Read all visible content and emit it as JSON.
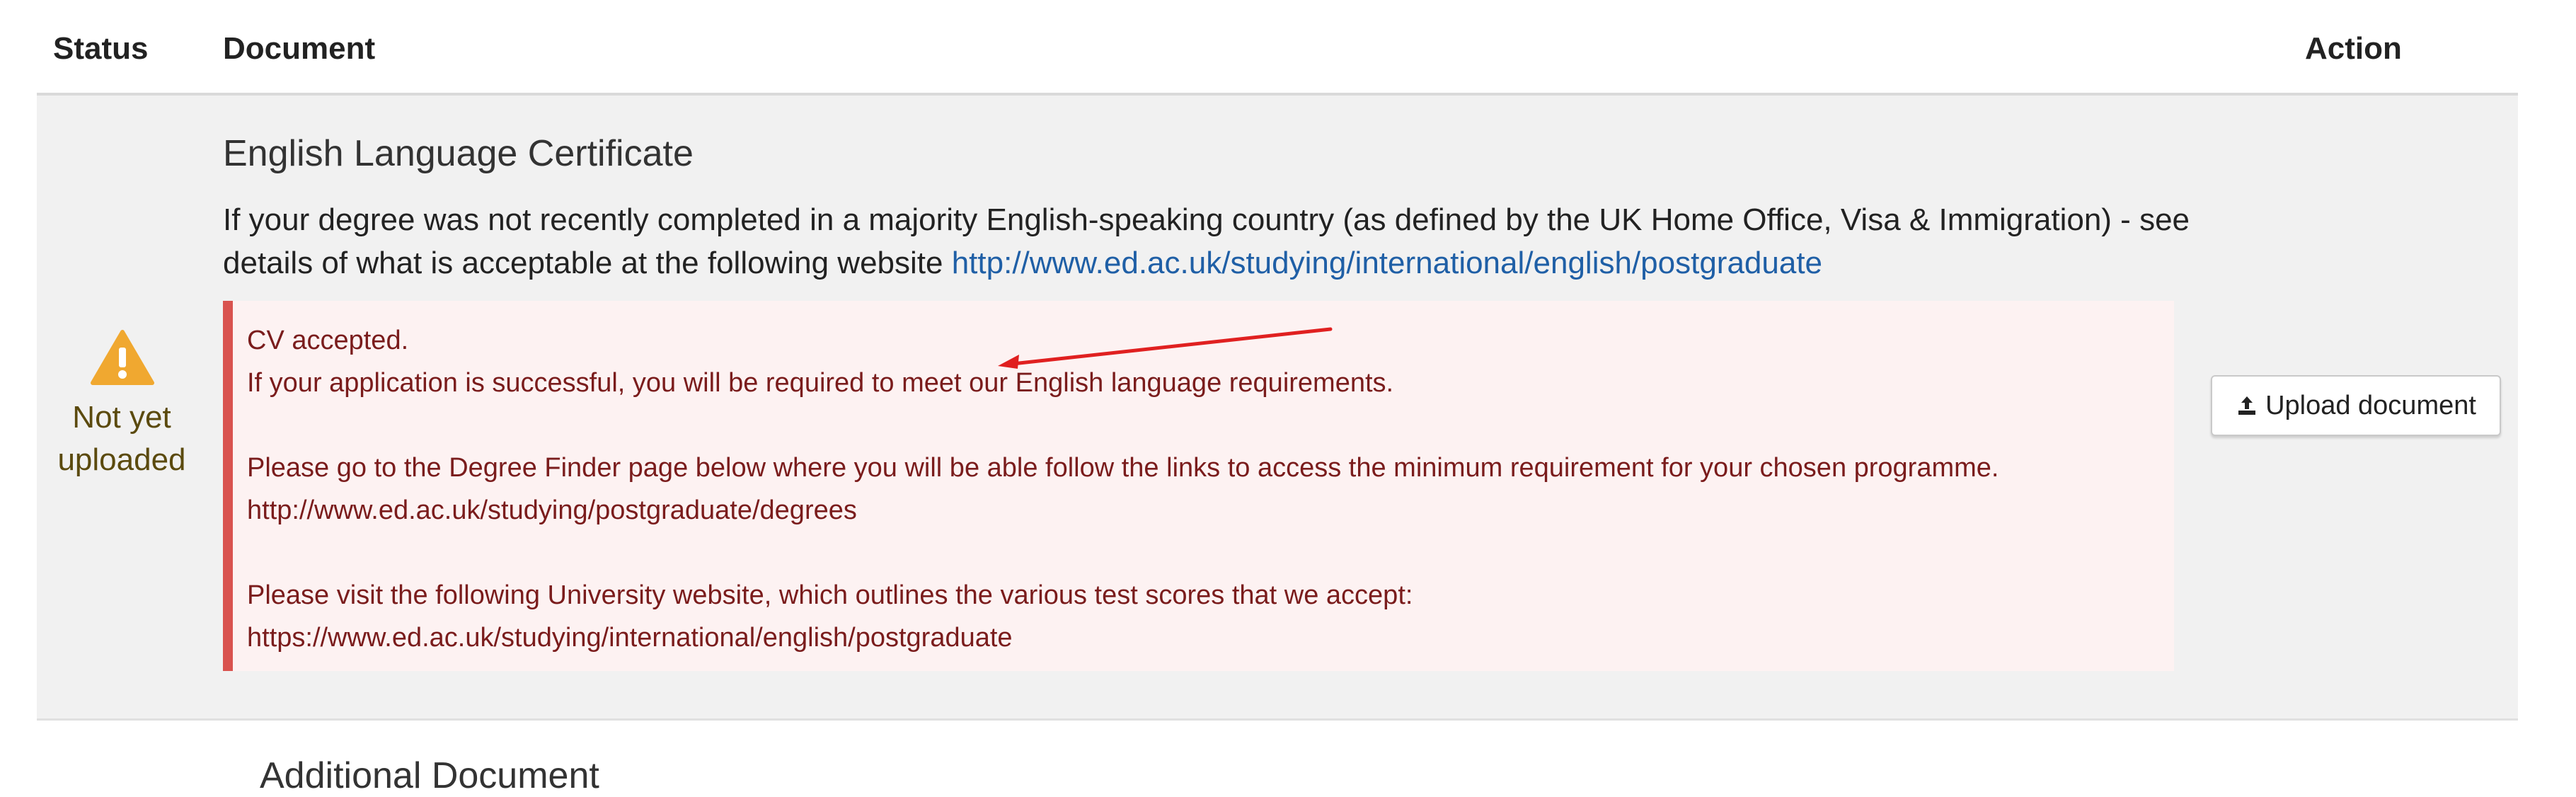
{
  "table": {
    "headers": {
      "status": "Status",
      "document": "Document",
      "action": "Action"
    }
  },
  "row": {
    "status_icon": "warning-icon",
    "status_label_line1": "Not yet",
    "status_label_line2": "uploaded",
    "title": "English Language Certificate",
    "description_text": "If your degree was not recently completed in a majority English-speaking country (as defined by the UK Home Office, Visa & Immigration) - see details of what is acceptable at the following website ",
    "description_link": "http://www.ed.ac.uk/studying/international/english/postgraduate",
    "alert_lines": [
      "CV accepted.",
      "If your application is successful, you will be required to meet our English language requirements.",
      "Please go to the Degree Finder page below where you will be able follow the links to access the minimum requirement for your chosen programme.",
      "http://www.ed.ac.uk/studying/postgraduate/degrees",
      "Please visit the following University website, which outlines the various test scores that we accept:",
      "https://www.ed.ac.uk/studying/international/english/postgraduate"
    ],
    "action_label": "Upload document",
    "action_icon": "upload-icon"
  },
  "next_row": {
    "title": "Additional Document"
  },
  "colors": {
    "warning": "#f0a830",
    "alert_border": "#d9534f",
    "alert_bg": "#fdf2f2",
    "alert_text": "#7a1c1c",
    "link": "#1f5fa6",
    "arrow": "#e02020"
  }
}
